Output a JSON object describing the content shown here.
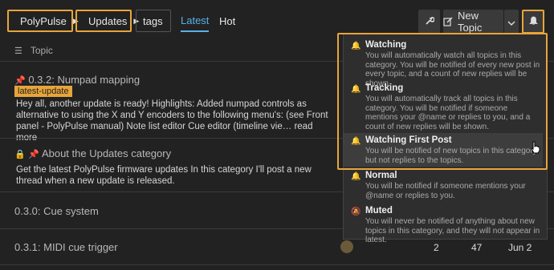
{
  "breadcrumbs": [
    {
      "label": "PolyPulse",
      "color": "#00a3a3"
    },
    {
      "label": "Updates",
      "color": "#e8a53a"
    },
    {
      "label": "tags"
    }
  ],
  "nav": {
    "latest": "Latest",
    "hot": "Hot"
  },
  "toolbar": {
    "new_topic": "New Topic"
  },
  "list_header": {
    "topic": "Topic"
  },
  "topics": [
    {
      "title": "0.3.2: Numpad mapping",
      "tag": "latest-update",
      "excerpt": "Hey all, another update is ready! Highlights: Added numpad controls as alternative to using the X and Y encoders to the following menu's: (see Front panel - PolyPulse manual) Note list editor Cue editor (timeline vie…",
      "read_more": "read more"
    },
    {
      "title": "About the Updates category",
      "excerpt": "Get the latest PolyPulse firmware updates In this category I'll post a new thread when a new update is released."
    },
    {
      "title": "0.3.0: Cue system"
    },
    {
      "title": "0.3.1: MIDI cue trigger",
      "replies": "2",
      "views": "47",
      "activity": "Jun 2"
    }
  ],
  "notification_menu": [
    {
      "title": "Watching",
      "desc": "You will automatically watch all topics in this category. You will be notified of every new post in every topic, and a count of new replies will be shown."
    },
    {
      "title": "Tracking",
      "desc": "You will automatically track all topics in this category. You will be notified if someone mentions your @name or replies to you, and a count of new replies will be shown."
    },
    {
      "title": "Watching First Post",
      "desc": "You will be notified of new topics in this category but not replies to the topics."
    },
    {
      "title": "Normal",
      "desc": "You will be notified if someone mentions your @name or replies to you."
    },
    {
      "title": "Muted",
      "desc": "You will never be notified of anything about new topics in this category, and they will not appear in latest."
    }
  ],
  "colors": {
    "accent": "#5ab0e8",
    "highlight": "#e8a53a",
    "polypulse": "#00a3a3",
    "updates": "#e8a53a"
  }
}
